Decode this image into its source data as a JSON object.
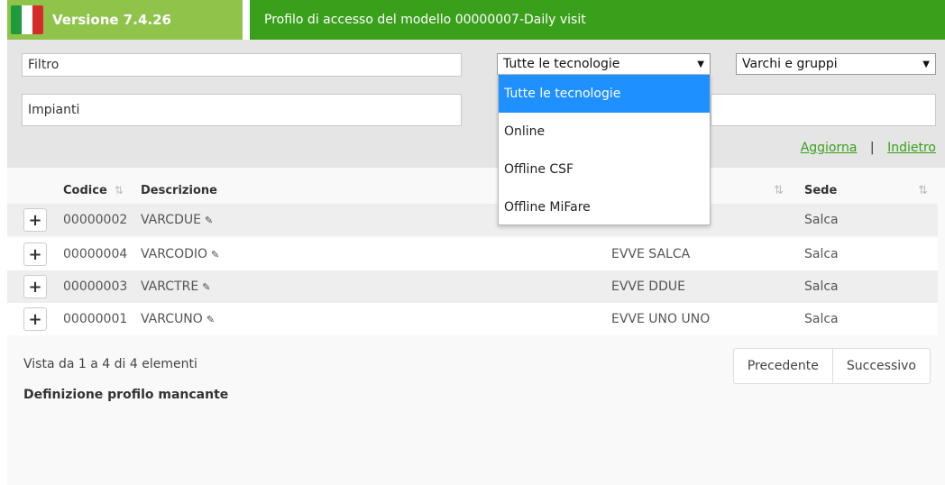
{
  "header": {
    "version": "Versione 7.4.26",
    "title": "Profilo di accesso del modello 00000007-Daily visit"
  },
  "filters": {
    "filter_placeholder": "Filtro",
    "technology_select": "Tutte le tecnologie",
    "group_select": "Varchi e gruppi",
    "impianti_placeholder": "Impianti",
    "dropdown_options": [
      "Tutte le tecnologie",
      "Online",
      "Offline CSF",
      "Offline MiFare"
    ]
  },
  "actions": {
    "refresh": "Aggiorna",
    "separator": "|",
    "back": "Indietro"
  },
  "table": {
    "headers": {
      "code": "Codice",
      "description": "Descrizione",
      "site": "Sede"
    },
    "rows": [
      {
        "code": "00000002",
        "description": "VARCDUE",
        "group": "",
        "site": "Salca"
      },
      {
        "code": "00000004",
        "description": "VARCODIO",
        "group": "EVVE SALCA",
        "site": "Salca"
      },
      {
        "code": "00000003",
        "description": "VARCTRE",
        "group": "EVVE DDUE",
        "site": "Salca"
      },
      {
        "code": "00000001",
        "description": "VARCUNO",
        "group": "EVVE UNO UNO",
        "site": "Salca"
      }
    ]
  },
  "footer": {
    "info": "Vista da 1 a 4 di 4 elementi",
    "prev": "Precedente",
    "next": "Successivo",
    "missing": "Definizione profilo mancante"
  }
}
